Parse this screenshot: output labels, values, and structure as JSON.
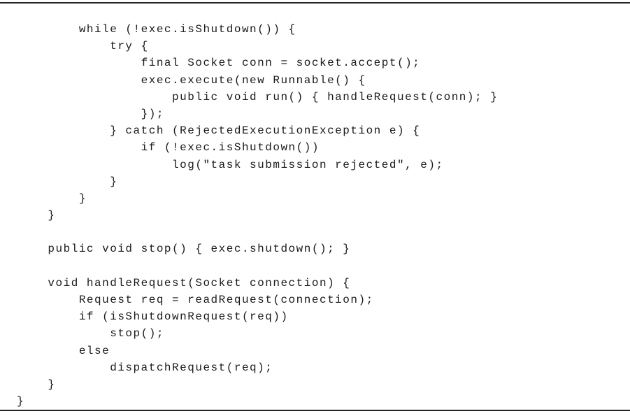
{
  "code_lines": [
    "        while (!exec.isShutdown()) {",
    "            try {",
    "                final Socket conn = socket.accept();",
    "                exec.execute(new Runnable() {",
    "                    public void run() { handleRequest(conn); }",
    "                });",
    "            } catch (RejectedExecutionException e) {",
    "                if (!exec.isShutdown())",
    "                    log(\"task submission rejected\", e);",
    "            }",
    "        }",
    "    }",
    "",
    "    public void stop() { exec.shutdown(); }",
    "",
    "    void handleRequest(Socket connection) {",
    "        Request req = readRequest(connection);",
    "        if (isShutdownRequest(req))",
    "            stop();",
    "        else",
    "            dispatchRequest(req);",
    "    }",
    "}"
  ]
}
